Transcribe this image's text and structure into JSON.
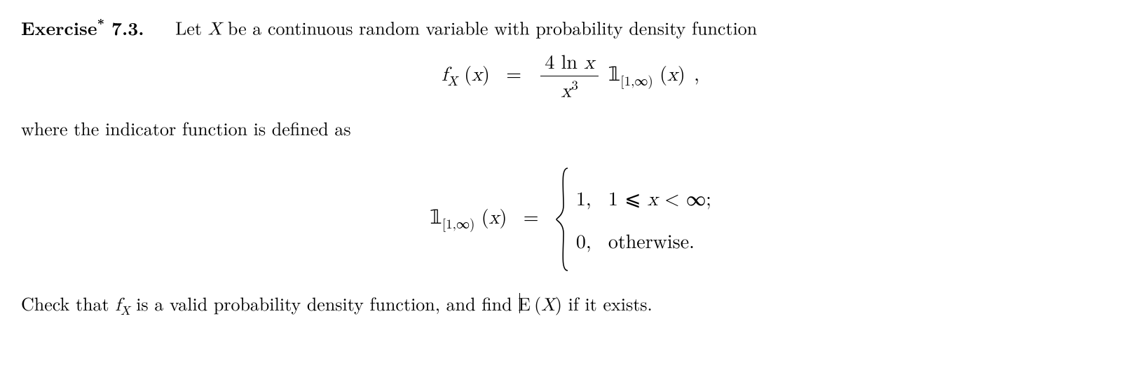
{
  "exercise": {
    "label": "Exercise",
    "star": "*",
    "number": "7.3.",
    "intro": "Let ",
    "var": "X",
    "intro2": " be a continuous random variable with probability density function"
  },
  "eq1": {
    "fX": "f",
    "Xsub": "X",
    "xarg": "x",
    "eq": "=",
    "num1": "4 ln ",
    "num2": "x",
    "den1": "x",
    "den_exp": "3",
    "indicator": "𝟙",
    "indrange": "[1,∞)",
    "comma": ","
  },
  "indicator_intro": "where the indicator function is defined as",
  "eq2": {
    "indicator": "𝟙",
    "indrange": "[1,∞)",
    "xarg": "x",
    "eq": "=",
    "case1_val": "1,",
    "case1_cond": "1 ⩽ x < ∞;",
    "case2_val": "0,",
    "case2_cond": "otherwise."
  },
  "final": {
    "t1": "Check that ",
    "fX": "f",
    "Xsub": "X",
    "t2": " is a valid probability density function, and find ",
    "E": "E",
    "paren_open": "(",
    "X": "X",
    "paren_close": ")",
    "t3": " if it exists."
  }
}
